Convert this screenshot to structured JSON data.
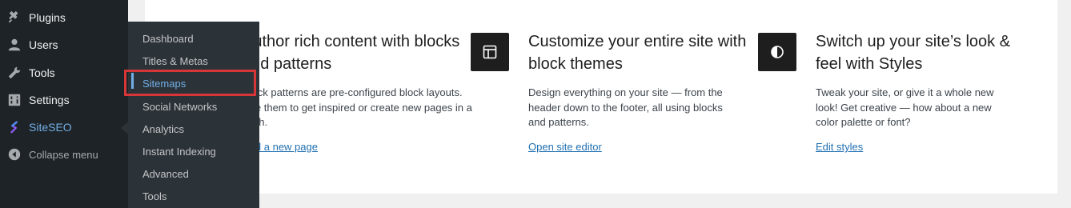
{
  "sidebar": {
    "items": [
      {
        "label": "Plugins",
        "icon": "plugins-icon"
      },
      {
        "label": "Users",
        "icon": "users-icon"
      },
      {
        "label": "Tools",
        "icon": "tools-icon"
      },
      {
        "label": "Settings",
        "icon": "settings-icon"
      },
      {
        "label": "SiteSEO",
        "icon": "siteseo-icon"
      }
    ],
    "collapse_label": "Collapse menu"
  },
  "flyout": {
    "items": [
      "Dashboard",
      "Titles & Metas",
      "Sitemaps",
      "Social Networks",
      "Analytics",
      "Instant Indexing",
      "Advanced",
      "Tools"
    ],
    "active": "Sitemaps"
  },
  "cards": [
    {
      "title": "Author rich content with blocks and patterns",
      "description": "Block patterns are pre-configured block layouts. Use them to get inspired or create new pages in a flash.",
      "link": "Add a new page"
    },
    {
      "title": "Customize your entire site with block themes",
      "description": "Design everything on your site — from the header down to the footer, all using blocks and patterns.",
      "link": "Open site editor",
      "icon": "layout-icon"
    },
    {
      "title": "Switch up your site’s look & feel with Styles",
      "description": "Tweak your site, or give it a whole new look! Get creative — how about a new color palette or font?",
      "link": "Edit styles",
      "icon": "contrast-icon"
    }
  ],
  "colors": {
    "sidebar_bg": "#1d2327",
    "flyout_bg": "#2c3338",
    "accent": "#72aee6",
    "highlight": "#d63638",
    "link": "#2271b1"
  }
}
